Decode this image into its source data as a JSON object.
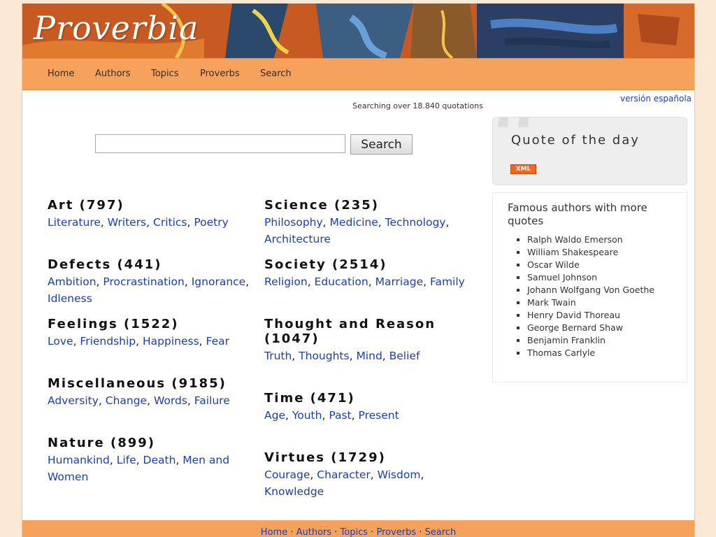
{
  "logo": "Proverbia",
  "nav": [
    "Home",
    "Authors",
    "Topics",
    "Proverbs",
    "Search"
  ],
  "lang_link": "versión española",
  "searching_text": "Searching over 18.840 quotations",
  "search": {
    "placeholder": "",
    "button": "Search"
  },
  "categories": [
    {
      "title": "Art (797)",
      "links": [
        "Literature",
        "Writers",
        "Critics",
        "Poetry"
      ]
    },
    {
      "title": "Science (235)",
      "links": [
        "Philosophy",
        "Medicine",
        "Technology",
        "Architecture"
      ]
    },
    {
      "title": "Defects (441)",
      "links": [
        "Ambition",
        "Procrastination",
        "Ignorance",
        "Idleness"
      ]
    },
    {
      "title": "Society (2514)",
      "links": [
        "Religion",
        "Education",
        "Marriage",
        "Family"
      ]
    },
    {
      "title": "Feelings (1522)",
      "links": [
        "Love",
        "Friendship",
        "Happiness",
        "Fear"
      ]
    },
    {
      "title": "Thought and Reason (1047)",
      "links": [
        "Truth",
        "Thoughts",
        "Mind",
        "Belief"
      ]
    },
    {
      "title": "Miscellaneous (9185)",
      "links": [
        "Adversity",
        "Change",
        "Words",
        "Failure"
      ]
    },
    {
      "title": "Time (471)",
      "links": [
        "Age",
        "Youth",
        "Past",
        "Present"
      ]
    },
    {
      "title": "Nature (899)",
      "links": [
        "Humankind",
        "Life",
        "Death",
        "Men and Women"
      ]
    },
    {
      "title": "Virtues (1729)",
      "links": [
        "Courage",
        "Character",
        "Wisdom",
        "Knowledge"
      ]
    }
  ],
  "quote_box": {
    "title": "Quote of the day",
    "xml_badge": "XML"
  },
  "authors_box": {
    "title": "Famous authors with more quotes",
    "authors": [
      "Ralph Waldo Emerson",
      "William Shakespeare",
      "Oscar Wilde",
      "Samuel Johnson",
      "Johann Wolfgang Von Goethe",
      "Mark Twain",
      "Henry David Thoreau",
      "George Bernard Shaw",
      "Benjamin Franklin",
      "Thomas Carlyle"
    ]
  },
  "footer": [
    "Home",
    "Authors",
    "Topics",
    "Proverbs",
    "Search"
  ],
  "colors": {
    "background": "#fbe9d5",
    "nav": "#f7a25c",
    "link": "#1a3fb0"
  }
}
